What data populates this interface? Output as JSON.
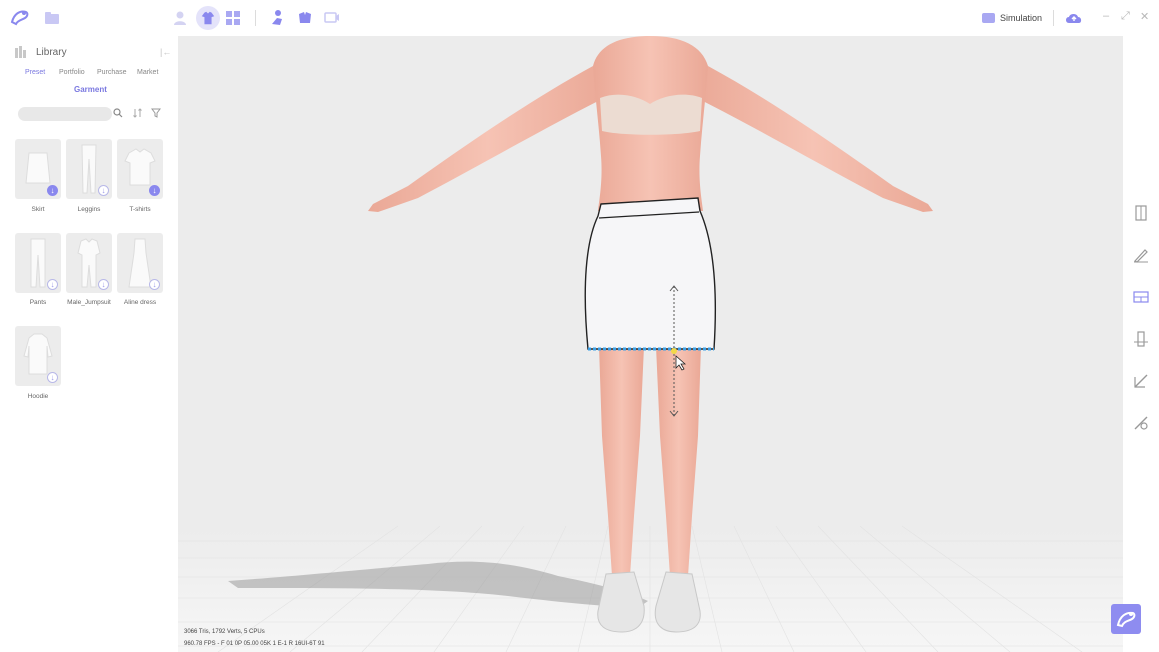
{
  "topbar": {
    "simulation_label": "Simulation",
    "icons": [
      "logo-icon",
      "folder-icon",
      "avatar-icon",
      "garment-icon",
      "grid-icon",
      "pose-icon",
      "fabric-icon",
      "record-icon",
      "cloud-upload-icon"
    ],
    "window_controls": [
      "–",
      "⤢",
      "✕"
    ]
  },
  "sidebar": {
    "title": "Library",
    "tabs": [
      {
        "label": "Preset",
        "active": true
      },
      {
        "label": "Portfolio",
        "active": false
      },
      {
        "label": "Purchase",
        "active": false
      },
      {
        "label": "Market",
        "active": false
      }
    ],
    "subtab": "Garment",
    "search_placeholder": "",
    "items": [
      {
        "label": "Skirt",
        "downloaded": true
      },
      {
        "label": "Leggins",
        "downloaded": false
      },
      {
        "label": "T-shirts",
        "downloaded": true
      },
      {
        "label": "Pants",
        "downloaded": false
      },
      {
        "label": "Male_Jumpsuit",
        "downloaded": false
      },
      {
        "label": "Aline dress",
        "downloaded": false
      },
      {
        "label": "Hoodie",
        "downloaded": false
      }
    ]
  },
  "viewport": {
    "stats_line1": "3066 Tris, 1792 Verts, 5 CPUs",
    "stats_line2": "960.78 FPS - F 01 0P 05.00 05K 1 E-1 R 16UI-6T 91"
  },
  "colors": {
    "accent": "#8a88ee",
    "viewport_bg": "#ececec",
    "floor_grid": "#f4f4f4",
    "skin": "#f2b8a8",
    "skirt": "#f6f6f8",
    "selection": "#3aa0e8"
  },
  "rightbar_icons": [
    "zipper-icon",
    "pen-icon",
    "sewing-icon",
    "fold-icon",
    "cut-icon",
    "pin-icon"
  ]
}
